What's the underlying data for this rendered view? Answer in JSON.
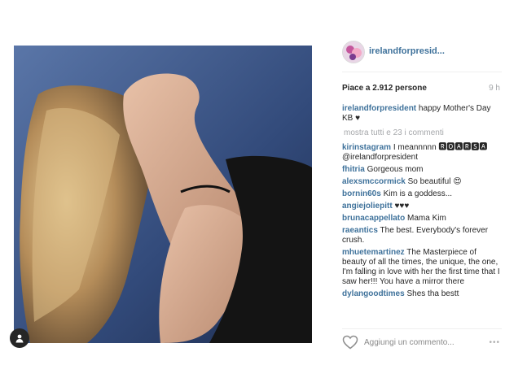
{
  "post": {
    "username": "irelandforpresid...",
    "likes_text": "Piace a 2.912 persone",
    "time_ago": "9 h",
    "caption": {
      "user": "irelandforpresident",
      "text": "happy Mother's Day KB ♥"
    },
    "show_all_comments": "mostra tutti e 23 i commenti",
    "comments": [
      {
        "user": "kirinstagram",
        "text": "I meannnnn 🆁🅾🅰🆁🆂🅰 @irelandforpresident"
      },
      {
        "user": "fhitria",
        "text": "Gorgeous mom"
      },
      {
        "user": "alexsmccormick",
        "text": "So beautiful 😍"
      },
      {
        "user": "bornin60s",
        "text": "Kim is a goddess..."
      },
      {
        "user": "angiejoliepitt",
        "text": "♥♥♥"
      },
      {
        "user": "brunacappellato",
        "text": "Mama Kim"
      },
      {
        "user": "raeantics",
        "text": "The best. Everybody's forever crush."
      },
      {
        "user": "mhuetemartinez",
        "text": "The Masterpiece of beauty of all the times, the unique, the one, I'm falling in love with her the first time that I saw her!!! You have a mirror there"
      },
      {
        "user": "dylangoodtimes",
        "text": "Shes tha bestt"
      }
    ],
    "add_comment_placeholder": "Aggiungi un commento...",
    "more_options": "•••"
  },
  "icons": {
    "heart": "heart-icon",
    "user_tag": "user-tag-icon",
    "more": "more-options-icon"
  },
  "colors": {
    "username": "#3f729b",
    "text": "#262626",
    "muted": "#a5a7aa",
    "photo_background": "#3d5a90"
  }
}
